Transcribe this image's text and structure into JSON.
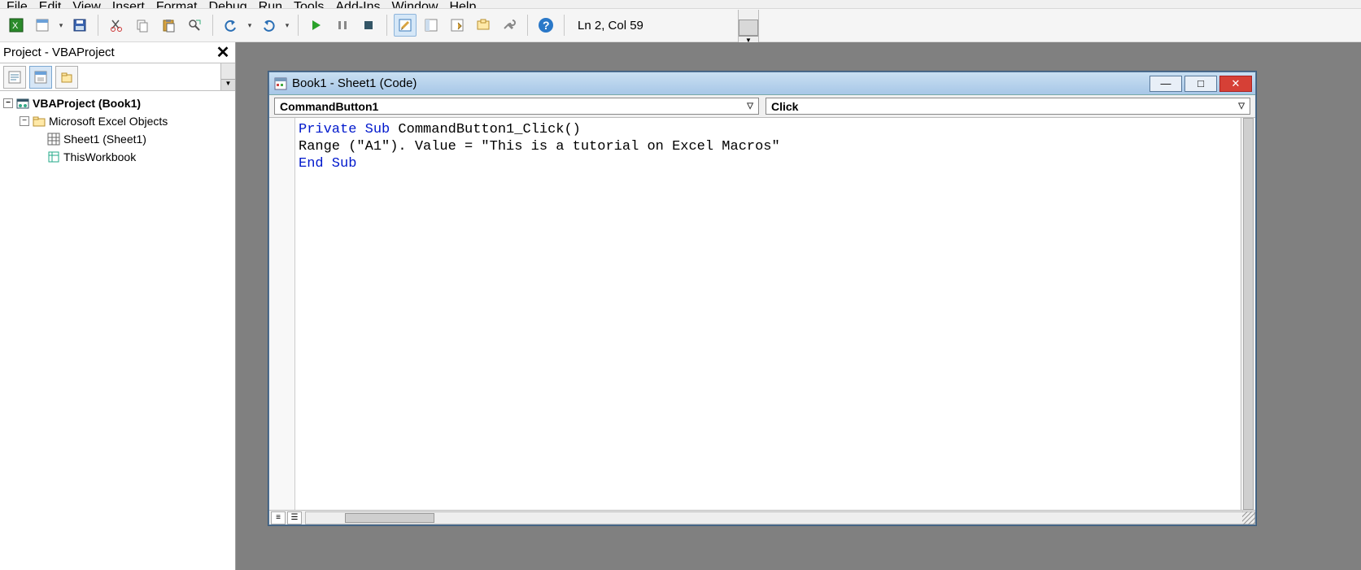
{
  "menu": {
    "file": "File",
    "edit": "Edit",
    "view": "View",
    "insert": "Insert",
    "format": "Format",
    "debug": "Debug",
    "run": "Run",
    "tools": "Tools",
    "addins": "Add-Ins",
    "window": "Window",
    "help": "Help"
  },
  "toolbar": {
    "status": "Ln 2, Col 59"
  },
  "panel": {
    "title": "Project - VBAProject",
    "tree": {
      "root": "VBAProject (Book1)",
      "folder": "Microsoft Excel Objects",
      "sheet": "Sheet1 (Sheet1)",
      "workbook": "ThisWorkbook"
    }
  },
  "codewin": {
    "title": "Book1 - Sheet1 (Code)",
    "object_combo": "CommandButton1",
    "proc_combo": "Click",
    "code": {
      "l1a": "Private",
      "l1b": " Sub",
      "l1c": " CommandButton1_Click()",
      "l2": "Range (\"A1\"). Value = \"This is a tutorial on Excel Macros\"",
      "l3": "End Sub"
    }
  }
}
